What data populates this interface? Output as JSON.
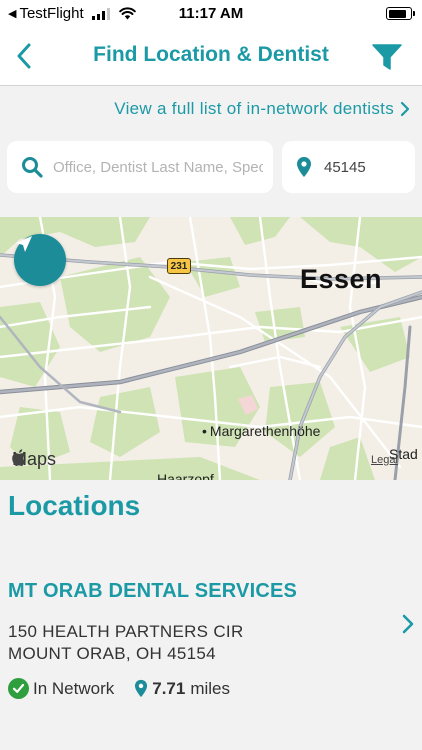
{
  "status_bar": {
    "back_app": "TestFlight",
    "time": "11:17 AM"
  },
  "nav": {
    "title": "Find Location & Dentist",
    "back_icon": "chevron-left-icon",
    "filter_icon": "filter-icon"
  },
  "full_list_link": "View a full list of in-network dentists",
  "search": {
    "placeholder": "Office, Dentist Last Name, Specialty",
    "zip_value": "45145"
  },
  "map": {
    "city_label": "Essen",
    "place_label": "Margarethenhöhe",
    "bottom_label": "Haarzopf",
    "edge_label": "Stad",
    "road_number": "231",
    "maps_logo": "Maps",
    "legal": "Legal"
  },
  "locations": {
    "title": "Locations",
    "items": [
      {
        "name": "MT ORAB DENTAL SERVICES",
        "address_line1": "150 HEALTH PARTNERS CIR",
        "address_line2": "MOUNT ORAB, OH 45154",
        "network_status": "In Network",
        "distance_value": "7.71",
        "distance_unit": "miles"
      }
    ]
  },
  "colors": {
    "accent": "#1b9aa6",
    "in_network": "#2e9e3e"
  }
}
